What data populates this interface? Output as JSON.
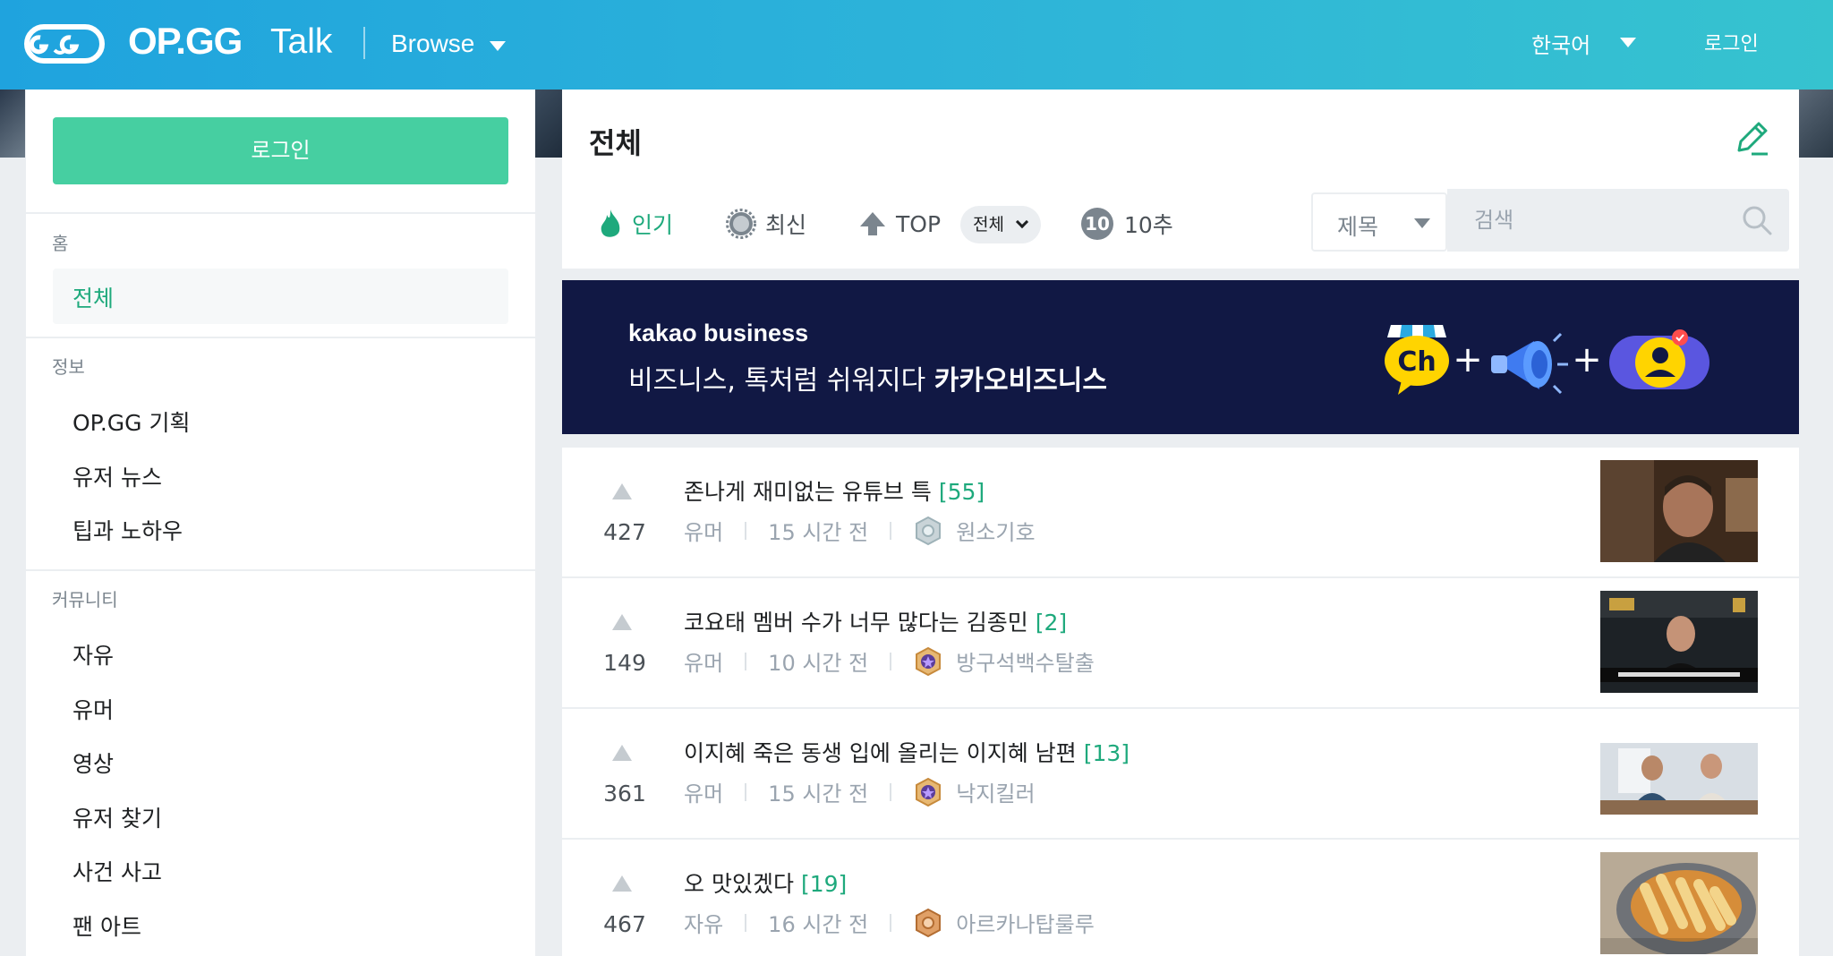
{
  "header": {
    "brand": "OP.GG",
    "brand_sub": "Talk",
    "browse_label": "Browse",
    "language": "한국어",
    "login_label": "로그인",
    "icons": {
      "logo": "opgg-logo-icon",
      "browse_caret": "caret-down-icon",
      "lang_caret": "caret-down-icon"
    }
  },
  "sidebar": {
    "login_button": "로그인",
    "home_section": "홈",
    "home_items": [
      {
        "label": "전체",
        "active": true
      }
    ],
    "info_section": "정보",
    "info_items": [
      {
        "label": "OP.GG 기획"
      },
      {
        "label": "유저 뉴스"
      },
      {
        "label": "팁과 노하우"
      }
    ],
    "community_section": "커뮤니티",
    "community_items": [
      {
        "label": "자유"
      },
      {
        "label": "유머"
      },
      {
        "label": "영상"
      },
      {
        "label": "유저 찾기"
      },
      {
        "label": "사건 사고"
      },
      {
        "label": "팬 아트"
      }
    ]
  },
  "main": {
    "title": "전체",
    "write_icon": "pencil-icon",
    "tabs": {
      "hot": {
        "label": "인기",
        "icon": "flame-icon",
        "active": true
      },
      "new": {
        "label": "최신",
        "icon": "gear-icon"
      },
      "top": {
        "label": "TOP",
        "icon": "arrow-up-icon",
        "filter": "전체"
      },
      "ten": {
        "label": "10추",
        "badge": "10"
      }
    },
    "search": {
      "scope": "제목",
      "placeholder": "검색",
      "icon": "search-icon"
    }
  },
  "banner": {
    "brand": "kakao business",
    "text_prefix": "비즈니스, 톡처럼 쉬워지다",
    "text_bold": "카카오비즈니스",
    "icons": [
      "channel-ch-icon",
      "megaphone-icon",
      "profile-badge-icon"
    ],
    "badge_text": "Ch",
    "plus": "+"
  },
  "posts": [
    {
      "votes": "427",
      "title": "존나게 재미없는 유튜브 특",
      "comments": "[55]",
      "category": "유머",
      "time": "15 시간 전",
      "author": "원소기호",
      "rank": "silver"
    },
    {
      "votes": "149",
      "title": "코요태 멤버 수가 너무 많다는 김종민",
      "comments": "[2]",
      "category": "유머",
      "time": "10 시간 전",
      "author": "방구석백수탈출",
      "rank": "master"
    },
    {
      "votes": "361",
      "title": "이지혜 죽은 동생 입에 올리는 이지혜 남편",
      "comments": "[13]",
      "category": "유머",
      "time": "15 시간 전",
      "author": "낙지킬러",
      "rank": "master"
    },
    {
      "votes": "467",
      "title": "오 맛있겠다",
      "comments": "[19]",
      "category": "자유",
      "time": "16 시간 전",
      "author": "아르카나탑룰루",
      "rank": "bronze"
    }
  ],
  "colors": {
    "accent": "#1ea97c",
    "login_button": "#46cfa1",
    "banner_bg": "#111844",
    "header_from": "#1fa3de",
    "header_to": "#36c3cf"
  }
}
